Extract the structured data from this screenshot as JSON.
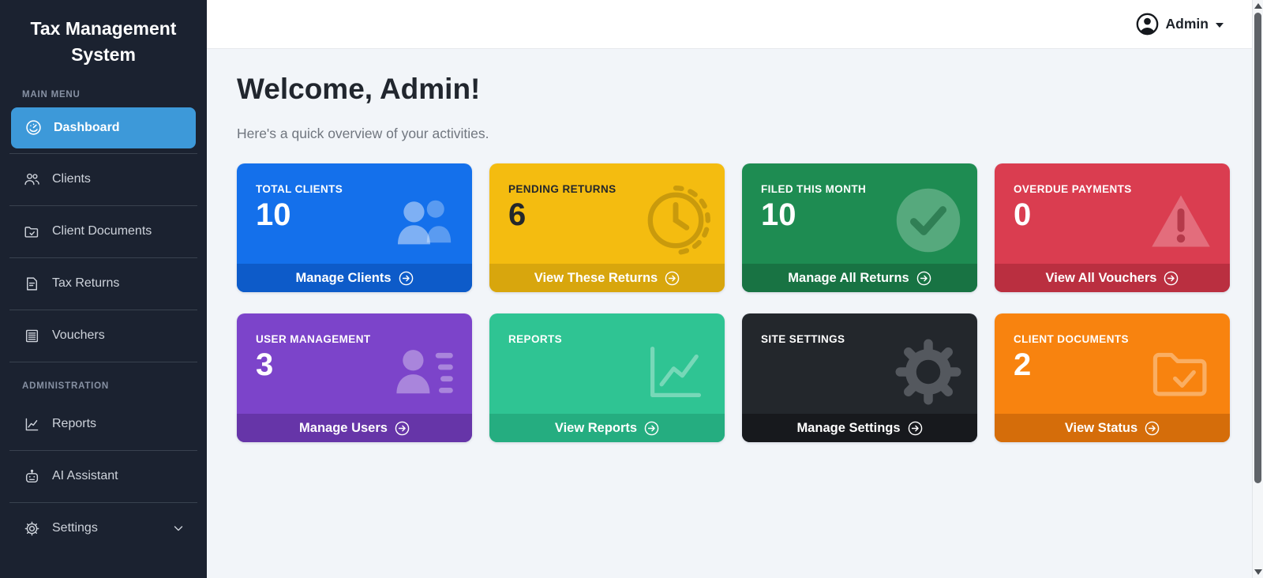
{
  "app": {
    "title": "Tax Management System"
  },
  "topbar": {
    "user_label": "Admin",
    "user_icon": "person-circle-icon"
  },
  "sidebar": {
    "sections": [
      {
        "label": "MAIN MENU",
        "items": [
          {
            "label": "Dashboard",
            "icon": "speedometer-icon",
            "active": true
          },
          {
            "label": "Clients",
            "icon": "people-icon",
            "active": false
          },
          {
            "label": "Client Documents",
            "icon": "folder-check-icon",
            "active": false
          },
          {
            "label": "Tax Returns",
            "icon": "file-text-icon",
            "active": false
          },
          {
            "label": "Vouchers",
            "icon": "receipt-icon",
            "active": false
          }
        ]
      },
      {
        "label": "ADMINISTRATION",
        "items": [
          {
            "label": "Reports",
            "icon": "graph-up-icon",
            "active": false
          },
          {
            "label": "AI Assistant",
            "icon": "robot-icon",
            "active": false
          },
          {
            "label": "Settings",
            "icon": "gear-icon",
            "active": false,
            "has_chevron": true
          }
        ]
      }
    ],
    "active_color": "#3d99d9",
    "background": "#1b2230"
  },
  "main": {
    "welcome_title": "Welcome, Admin!",
    "welcome_subtitle": "Here's a quick overview of your activities.",
    "cards": [
      {
        "label": "TOTAL CLIENTS",
        "value": "10",
        "action": "Manage Clients",
        "icon": "people-icon",
        "bg": "#1470eb",
        "footer_bg": "#0d5bc9",
        "text_color": "#ffffff",
        "footer_text_color": "#ffffff"
      },
      {
        "label": "PENDING RETURNS",
        "value": "6",
        "action": "View These Returns",
        "icon": "clock-icon",
        "bg": "#f4bc10",
        "footer_bg": "#d8a60d",
        "text_color": "#23272c",
        "footer_text_color": "#ffffff"
      },
      {
        "label": "FILED THIS MONTH",
        "value": "10",
        "action": "Manage All Returns",
        "icon": "check-circle-icon",
        "bg": "#1e8c52",
        "footer_bg": "#187343",
        "text_color": "#ffffff",
        "footer_text_color": "#ffffff"
      },
      {
        "label": "OVERDUE PAYMENTS",
        "value": "0",
        "action": "View All Vouchers",
        "icon": "exclamation-triangle-icon",
        "bg": "#da3d50",
        "footer_bg": "#ba2f40",
        "text_color": "#ffffff",
        "footer_text_color": "#ffffff"
      },
      {
        "label": "USER MANAGEMENT",
        "value": "3",
        "action": "Manage Users",
        "icon": "person-lines-icon",
        "bg": "#7c44ca",
        "footer_bg": "#6635a8",
        "text_color": "#ffffff",
        "footer_text_color": "#ffffff"
      },
      {
        "label": "REPORTS",
        "value": "",
        "action": "View Reports",
        "icon": "graph-up-icon",
        "bg": "#2fc493",
        "footer_bg": "#25ad80",
        "text_color": "#ffffff",
        "footer_text_color": "#ffffff"
      },
      {
        "label": "SITE SETTINGS",
        "value": "",
        "action": "Manage Settings",
        "icon": "gear-icon",
        "bg": "#23272c",
        "footer_bg": "#17191d",
        "text_color": "#ffffff",
        "footer_text_color": "#ffffff"
      },
      {
        "label": "CLIENT DOCUMENTS",
        "value": "2",
        "action": "View Status",
        "icon": "folder-check-icon",
        "bg": "#f8830f",
        "footer_bg": "#d56d0a",
        "text_color": "#ffffff",
        "footer_text_color": "#ffffff"
      }
    ]
  }
}
